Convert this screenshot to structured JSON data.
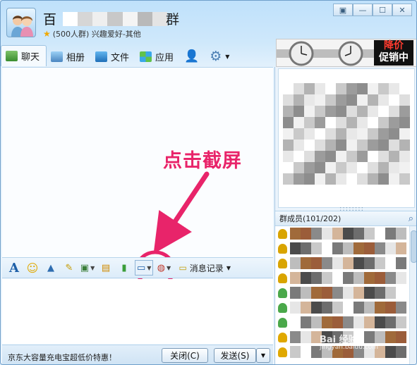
{
  "window": {
    "title_start": "百",
    "title_end": "群",
    "subtitle": "(500人群) 兴趣爱好-其他",
    "buttons": [
      "▣",
      "—",
      "☐",
      "✕"
    ]
  },
  "tabs": [
    {
      "label": "聊天",
      "icon": "chat-icon"
    },
    {
      "label": "相册",
      "icon": "photo-icon"
    },
    {
      "label": "文件",
      "icon": "folder-icon"
    },
    {
      "label": "应用",
      "icon": "apps-icon"
    }
  ],
  "ad": {
    "line1": "降价",
    "line2": "促销中"
  },
  "annotation": "点击截屏",
  "toolbar": {
    "icons": [
      "font-icon",
      "emoji-icon",
      "magic-icon",
      "doodle-icon",
      "image-icon",
      "send-file-icon",
      "screenshot-icon",
      "shake-icon",
      "history-icon"
    ],
    "history_label": "消息记录"
  },
  "bottom": {
    "promo": "京东大容量充电宝超低价特惠！",
    "close_label": "关闭(C)",
    "send_label": "发送(S)"
  },
  "members": {
    "header": "群成员(101/202)",
    "row_count": 9
  },
  "watermark": {
    "brand": "Bai 经验",
    "url": "jingyan.baidu.com"
  },
  "colors": {
    "annotation": "#e8246a",
    "accent": "#1d5fa8"
  }
}
